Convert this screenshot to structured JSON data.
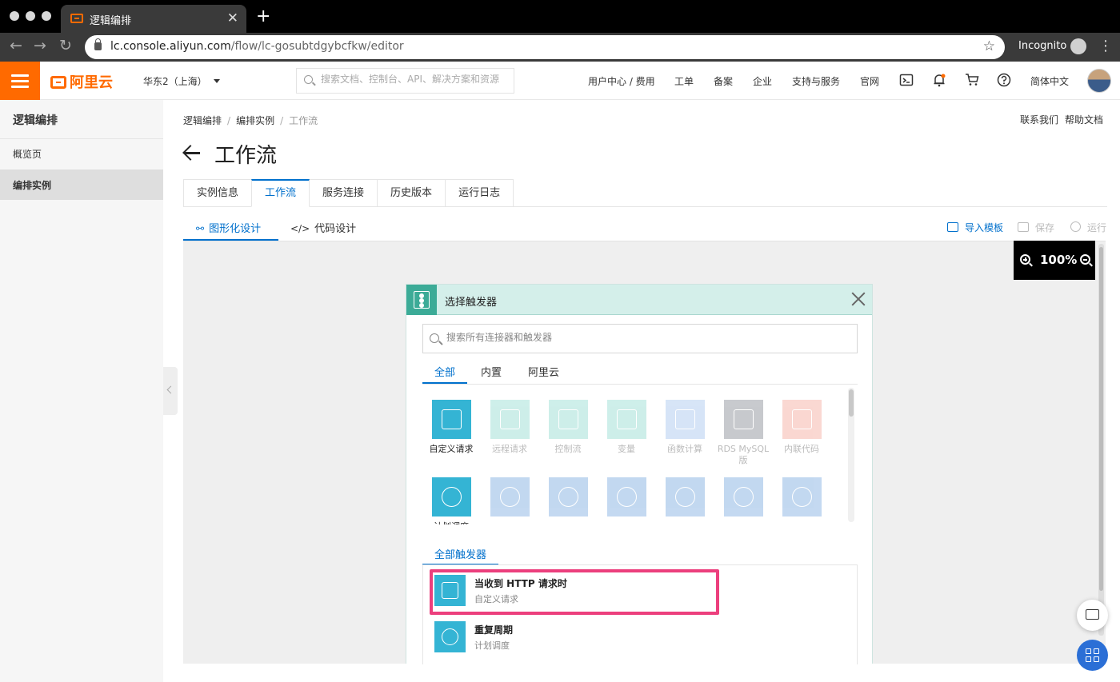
{
  "browser": {
    "tab_title": "逻辑编排",
    "url_host": "lc.console.aliyun.com",
    "url_path": "/flow/lc-gosubtdgybcfkw/editor",
    "incognito_label": "Incognito"
  },
  "header": {
    "logo_text": "阿里云",
    "region": "华东2（上海）",
    "search_placeholder": "搜索文档、控制台、API、解决方案和资源",
    "nav": [
      "用户中心 / 费用",
      "工单",
      "备案",
      "企业",
      "支持与服务",
      "官网"
    ],
    "language": "简体中文",
    "icons": [
      "terminal-icon",
      "bell-icon",
      "cart-icon",
      "help-icon"
    ]
  },
  "sidebar": {
    "title": "逻辑编排",
    "items": [
      {
        "label": "概览页",
        "active": false
      },
      {
        "label": "编排实例",
        "active": true
      }
    ]
  },
  "breadcrumb": [
    "逻辑编排",
    "编排实例",
    "工作流"
  ],
  "toplinks": [
    "联系我们",
    "帮助文档"
  ],
  "page_title": "工作流",
  "tabs": [
    {
      "label": "实例信息",
      "active": false
    },
    {
      "label": "工作流",
      "active": true
    },
    {
      "label": "服务连接",
      "active": false
    },
    {
      "label": "历史版本",
      "active": false
    },
    {
      "label": "运行日志",
      "active": false
    }
  ],
  "subtabs": [
    {
      "label": "图形化设计",
      "active": true,
      "icon": "tree-icon"
    },
    {
      "label": "代码设计",
      "active": false,
      "icon": "code-icon"
    }
  ],
  "actions": {
    "import": "导入模板",
    "save": "保存",
    "run": "运行"
  },
  "zoom": "100%",
  "panel": {
    "title": "选择触发器",
    "search_placeholder": "搜索所有连接器和触发器",
    "tabs": [
      {
        "label": "全部",
        "active": true
      },
      {
        "label": "内置",
        "active": false
      },
      {
        "label": "阿里云",
        "active": false
      }
    ],
    "connectors_row1": [
      {
        "label": "自定义请求",
        "enabled": true,
        "color": "#34b4d4"
      },
      {
        "label": "远程请求",
        "enabled": false,
        "color": "#5cc9b8"
      },
      {
        "label": "控制流",
        "enabled": false,
        "color": "#5cc9b8"
      },
      {
        "label": "变量",
        "enabled": false,
        "color": "#5cc9b8"
      },
      {
        "label": "函数计算",
        "enabled": false,
        "color": "#7aa9e6"
      },
      {
        "label": "RDS MySQL版",
        "enabled": false,
        "color": "#4a4f5c"
      },
      {
        "label": "内联代码",
        "enabled": false,
        "color": "#f07d6a"
      }
    ],
    "connectors_row2": [
      {
        "label": "计划调度",
        "enabled": true,
        "color": "#34b4d4"
      },
      {
        "label": "",
        "enabled": false,
        "color": "#3a82cf"
      },
      {
        "label": "",
        "enabled": false,
        "color": "#3a82cf"
      },
      {
        "label": "",
        "enabled": false,
        "color": "#3a82cf"
      },
      {
        "label": "",
        "enabled": false,
        "color": "#3a82cf"
      },
      {
        "label": "",
        "enabled": false,
        "color": "#3a82cf"
      },
      {
        "label": "",
        "enabled": false,
        "color": "#3a82cf"
      }
    ],
    "all_triggers_tab": "全部触发器",
    "triggers": [
      {
        "name": "当收到 HTTP 请求时",
        "sub": "自定义请求",
        "icon": "http-request-icon",
        "highlighted": true
      },
      {
        "name": "重复周期",
        "sub": "计划调度",
        "icon": "timer-icon",
        "highlighted": false
      }
    ]
  },
  "colors": {
    "brand": "#ff6a00",
    "accent": "#0070cc",
    "panel_header": "#d4efea",
    "highlight": "#ec3f7d"
  }
}
